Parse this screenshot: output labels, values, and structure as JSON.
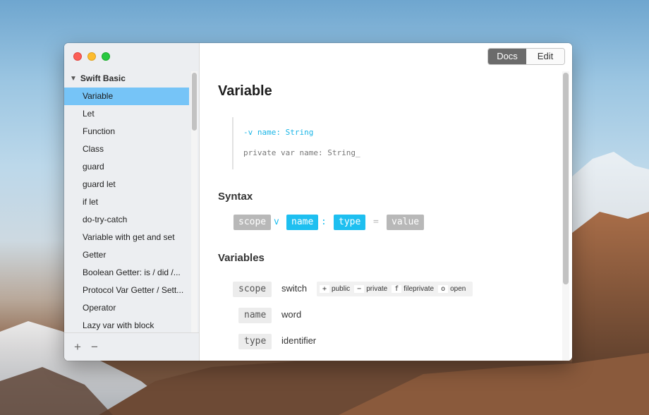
{
  "sidebar": {
    "group_title": "Swift Basic",
    "items": [
      {
        "label": "Variable"
      },
      {
        "label": "Let"
      },
      {
        "label": "Function"
      },
      {
        "label": "Class"
      },
      {
        "label": "guard"
      },
      {
        "label": "guard let"
      },
      {
        "label": "if let"
      },
      {
        "label": "do-try-catch"
      },
      {
        "label": "Variable with get and set"
      },
      {
        "label": "Getter"
      },
      {
        "label": "Boolean Getter: is / did /..."
      },
      {
        "label": "Protocol Var Getter / Sett..."
      },
      {
        "label": "Operator"
      },
      {
        "label": "Lazy var with block"
      }
    ],
    "add_label": "+",
    "remove_label": "−"
  },
  "toolbar": {
    "docs_label": "Docs",
    "edit_label": "Edit"
  },
  "main": {
    "title": "Variable",
    "code_abbr": "-v name: String",
    "code_expanded": "private var name: String_",
    "syntax_heading": "Syntax",
    "syntax": {
      "scope": "scope",
      "v": "v",
      "name": "name",
      "colon": ":",
      "type": "type",
      "eq": "=",
      "value": "value"
    },
    "variables_heading": "Variables",
    "variables": {
      "scope_key": "scope",
      "scope_desc": "switch",
      "name_key": "name",
      "name_desc": "word",
      "type_key": "type",
      "type_desc": "identifier"
    },
    "switch_options": [
      {
        "key": "+",
        "label": "public"
      },
      {
        "key": "−",
        "label": "private"
      },
      {
        "key": "f",
        "label": "fileprivate"
      },
      {
        "key": "o",
        "label": "open"
      }
    ]
  },
  "colors": {
    "accent": "#1ebff0",
    "selection": "#76c4f7"
  }
}
